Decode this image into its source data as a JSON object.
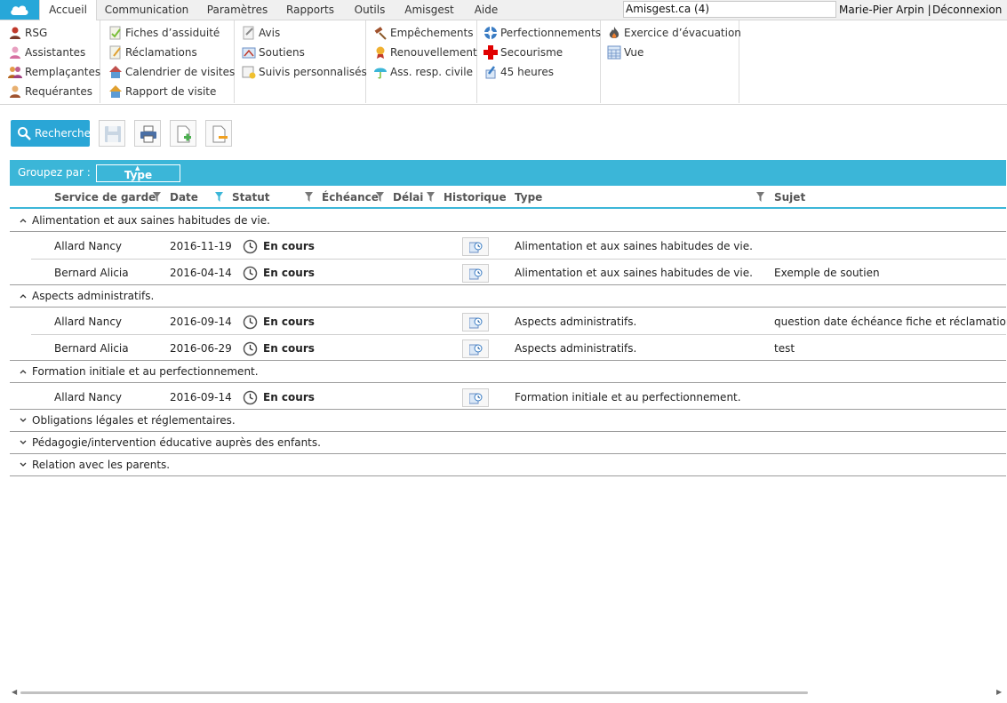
{
  "menu": {
    "tabs": [
      "Accueil",
      "Communication",
      "Paramètres",
      "Rapports",
      "Outils",
      "Amisgest",
      "Aide"
    ],
    "active_tab": "Accueil",
    "search_value": "Amisgest.ca (4)",
    "user": "Marie-Pier Arpin |",
    "logout": "Déconnexion"
  },
  "ribbon": {
    "groups": [
      [
        "RSG",
        "Assistantes",
        "Remplaçantes",
        "Requérantes"
      ],
      [
        "Fiches d’assiduité",
        "Réclamations",
        "Calendrier de visites",
        "Rapport de visite"
      ],
      [
        "Avis",
        "Soutiens",
        "Suivis personnalisés"
      ],
      [
        "Empêchements",
        "Renouvellement",
        "Ass. resp. civile"
      ],
      [
        "Perfectionnements",
        "Secourisme",
        "45 heures"
      ],
      [
        "Exercice d’évacuation",
        "Vue"
      ]
    ]
  },
  "toolbar": {
    "search_label": "Rechercher"
  },
  "groupby": {
    "label": "Groupez par :",
    "chip": "Type"
  },
  "columns": {
    "service": "Service de garde",
    "date": "Date",
    "statut": "Statut",
    "echeance": "Échéance",
    "delai": "Délai",
    "historique": "Historique",
    "type": "Type",
    "sujet": "Sujet"
  },
  "groups": [
    {
      "title": "Alimentation et aux saines habitudes de vie.",
      "expanded": true,
      "rows": [
        {
          "service": "Allard Nancy",
          "date": "2016-11-19",
          "statut": "En cours",
          "type": "Alimentation et aux saines habitudes de vie.",
          "sujet": ""
        },
        {
          "service": "Bernard Alicia",
          "date": "2016-04-14",
          "statut": "En cours",
          "type": "Alimentation et aux saines habitudes de vie.",
          "sujet": "Exemple de soutien"
        }
      ]
    },
    {
      "title": "Aspects administratifs.",
      "expanded": true,
      "rows": [
        {
          "service": "Allard Nancy",
          "date": "2016-09-14",
          "statut": "En cours",
          "type": "Aspects administratifs.",
          "sujet": "question date échéance fiche et réclamations"
        },
        {
          "service": "Bernard Alicia",
          "date": "2016-06-29",
          "statut": "En cours",
          "type": "Aspects administratifs.",
          "sujet": "test"
        }
      ]
    },
    {
      "title": "Formation initiale et au perfectionnement.",
      "expanded": true,
      "rows": [
        {
          "service": "Allard Nancy",
          "date": "2016-09-14",
          "statut": "En cours",
          "type": "Formation initiale et au perfectionnement.",
          "sujet": ""
        }
      ]
    },
    {
      "title": "Obligations légales et réglementaires.",
      "expanded": false,
      "rows": []
    },
    {
      "title": "Pédagogie/intervention éducative auprès des enfants.",
      "expanded": false,
      "rows": []
    },
    {
      "title": "Relation avec les parents.",
      "expanded": false,
      "rows": []
    }
  ],
  "colors": {
    "accent": "#3bb6d8",
    "button": "#2aa6d6"
  }
}
